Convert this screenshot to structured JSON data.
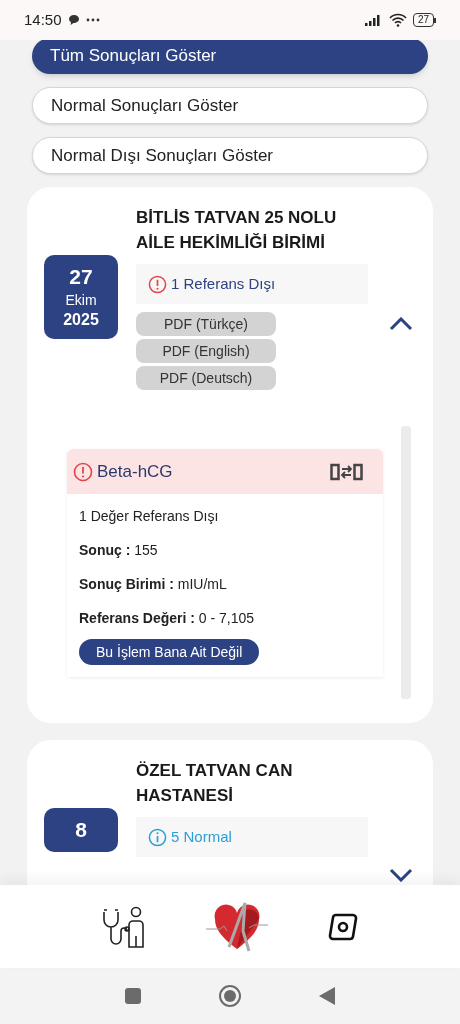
{
  "status_bar": {
    "time": "14:50",
    "battery": "27"
  },
  "filters": [
    {
      "label": "Tüm Sonuçları Göster",
      "selected": true
    },
    {
      "label": "Normal Sonuçları Göster",
      "selected": false
    },
    {
      "label": "Normal Dışı Sonuçları Göster",
      "selected": false
    }
  ],
  "results": [
    {
      "title": "BİTLİS TATVAN 25 NOLU AİLE HEKİMLİĞİ BİRİMİ",
      "day": "27",
      "month": "Ekim",
      "year": "2025",
      "summary": {
        "kind": "out_of_range",
        "text": "1 Referans Dışı"
      },
      "expanded": true,
      "pdfs": [
        "PDF (Türkçe)",
        "PDF (English)",
        "PDF (Deutsch)"
      ],
      "tests": [
        {
          "name": "Beta-hCG",
          "kind": "out_of_range",
          "note": "1 Değer Referans Dışı",
          "fields": [
            "**Sonuç :** 155",
            "**Sonuç Birimi :** mIU/mL",
            "**Referans Değeri :** 0 - 7,105"
          ],
          "button": "Bu İşlem Bana Ait Değil"
        }
      ]
    },
    {
      "title": "ÖZEL TATVAN CAN HASTANESİ",
      "day": "8",
      "summary": {
        "kind": "normal",
        "text": "5 Normal"
      },
      "expanded": false
    }
  ]
}
